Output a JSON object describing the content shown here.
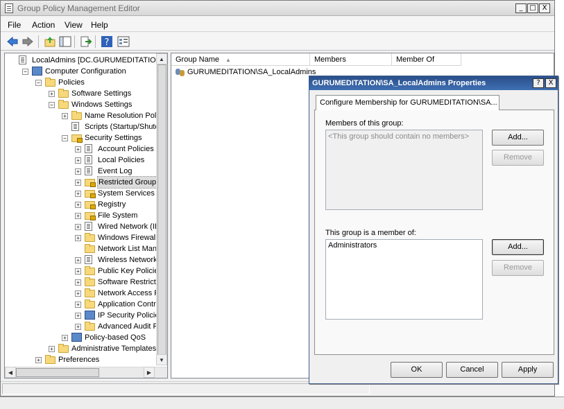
{
  "window": {
    "title": "Group Policy Management Editor",
    "caption_buttons": [
      "_",
      "□",
      "X"
    ]
  },
  "menu": [
    "File",
    "Action",
    "View",
    "Help"
  ],
  "toolbar": {
    "icons": [
      "back-arrow-icon",
      "forward-arrow-icon",
      "up-folder-icon",
      "show-hide-tree-icon",
      "export-list-icon",
      "help-icon",
      "properties-icon"
    ]
  },
  "tree": {
    "items": [
      {
        "label": "LocalAdmins [DC.GURUMEDITATION.LOC",
        "expander": "",
        "icon": "policy-icon"
      },
      {
        "label": "Computer Configuration",
        "expander": "−",
        "icon": "computer-icon"
      },
      {
        "label": "Policies",
        "expander": "−",
        "icon": "folder-icon"
      },
      {
        "label": "Software Settings",
        "expander": "+",
        "icon": "folder-icon"
      },
      {
        "label": "Windows Settings",
        "expander": "−",
        "icon": "folder-icon"
      },
      {
        "label": "Name Resolution Policy",
        "expander": "+",
        "icon": "folder-icon"
      },
      {
        "label": "Scripts (Startup/Shutdow",
        "expander": "",
        "icon": "script-icon"
      },
      {
        "label": "Security Settings",
        "expander": "−",
        "icon": "security-folder-icon"
      },
      {
        "label": "Account Policies",
        "expander": "+",
        "icon": "policy-doc-icon"
      },
      {
        "label": "Local Policies",
        "expander": "+",
        "icon": "policy-doc-icon"
      },
      {
        "label": "Event Log",
        "expander": "+",
        "icon": "policy-doc-icon"
      },
      {
        "label": "Restricted Groups",
        "expander": "+",
        "icon": "security-folder-icon"
      },
      {
        "label": "System Services",
        "expander": "+",
        "icon": "security-folder-icon"
      },
      {
        "label": "Registry",
        "expander": "+",
        "icon": "security-folder-icon"
      },
      {
        "label": "File System",
        "expander": "+",
        "icon": "security-folder-icon"
      },
      {
        "label": "Wired Network (IEEE",
        "expander": "+",
        "icon": "network-icon"
      },
      {
        "label": "Windows Firewall wit",
        "expander": "+",
        "icon": "folder-icon"
      },
      {
        "label": "Network List Manage",
        "expander": "",
        "icon": "folder-icon"
      },
      {
        "label": "Wireless Network (IE",
        "expander": "+",
        "icon": "wireless-icon"
      },
      {
        "label": "Public Key Policies",
        "expander": "+",
        "icon": "folder-icon"
      },
      {
        "label": "Software Restriction",
        "expander": "+",
        "icon": "folder-icon"
      },
      {
        "label": "Network Access Prot",
        "expander": "+",
        "icon": "folder-icon"
      },
      {
        "label": "Application Control P",
        "expander": "+",
        "icon": "folder-icon"
      },
      {
        "label": "IP Security Policies or",
        "expander": "+",
        "icon": "ip-security-icon"
      },
      {
        "label": "Advanced Audit Polic",
        "expander": "+",
        "icon": "folder-icon"
      },
      {
        "label": "Policy-based QoS",
        "expander": "+",
        "icon": "qos-chart-icon"
      },
      {
        "label": "Administrative Templates: Po",
        "expander": "+",
        "icon": "folder-icon"
      },
      {
        "label": "Preferences",
        "expander": "+",
        "icon": "folder-icon"
      }
    ],
    "selected_index": 11
  },
  "list": {
    "columns": [
      "Group Name",
      "Members",
      "Member Of"
    ],
    "sort_indicator": "▲",
    "rows": [
      {
        "group_name": "GURUMEDITATION\\SA_LocalAdmins",
        "members": "",
        "member_of": ""
      }
    ]
  },
  "dialog": {
    "title": "GURUMEDITATION\\SA_LocalAdmins Properties",
    "help_button": "?",
    "close_button": "X",
    "tab_label": "Configure Membership for GURUMEDITATION\\SA...",
    "members_label": "Members of this group:",
    "members_placeholder": "<This group should contain no members>",
    "member_of_label": "This group is a member of:",
    "member_of_items": [
      "Administrators"
    ],
    "add_label": "Add...",
    "remove_label": "Remove",
    "ok_label": "OK",
    "cancel_label": "Cancel",
    "apply_label": "Apply"
  }
}
